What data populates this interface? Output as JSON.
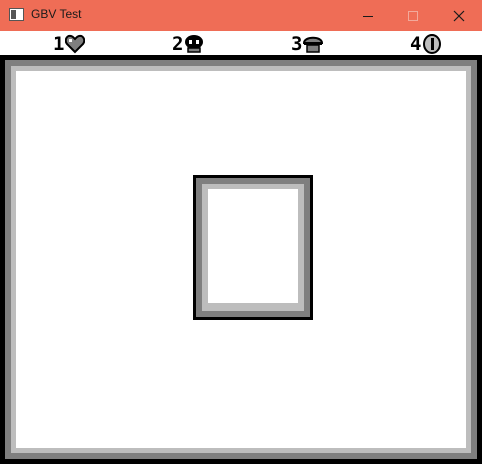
{
  "window": {
    "title": "GBV Test",
    "titlebar_color": "#ef6d56",
    "controls": [
      "minimize-icon",
      "maximize-icon",
      "close-icon"
    ]
  },
  "status": {
    "slots": [
      {
        "number": "1",
        "icon": "heart-icon"
      },
      {
        "number": "2",
        "icon": "round-face-icon"
      },
      {
        "number": "3",
        "icon": "helmet-face-icon"
      },
      {
        "number": "4",
        "icon": "coin-icon"
      }
    ]
  },
  "palette": {
    "darkest": "#000000",
    "dark": "#7f7f7f",
    "light": "#bdbdbd",
    "lightest": "#ffffff"
  }
}
